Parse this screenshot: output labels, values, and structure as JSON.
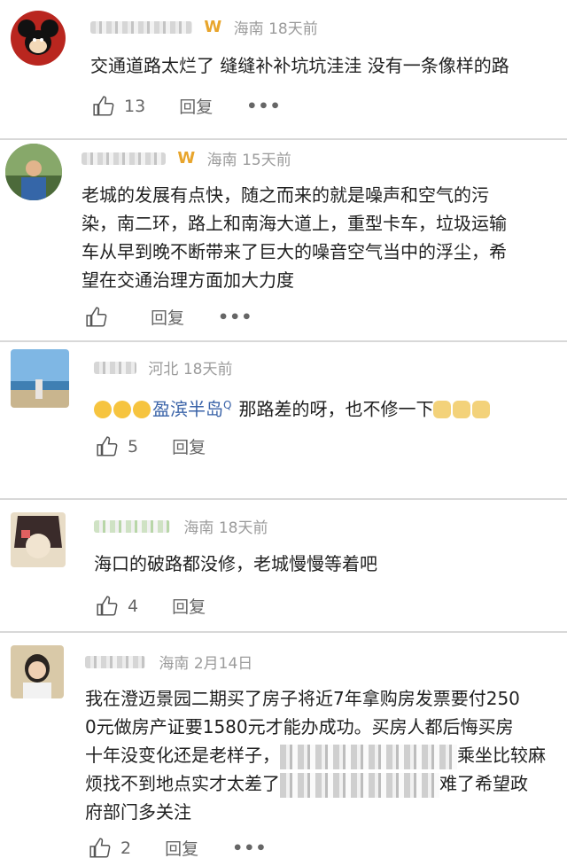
{
  "comments": [
    {
      "location": "海南",
      "time": "18天前",
      "vip_badge": "W",
      "text_lines": [
        "交通道路太烂了 缝缝补补坑坑洼洼 没有一条像样的路"
      ],
      "like_count": "13",
      "reply_label": "回复",
      "more_label": "•••"
    },
    {
      "location": "海南",
      "time": "15天前",
      "vip_badge": "W",
      "text_lines": [
        "老城的发展有点快，随之而来的就是噪声和空气的污",
        "染，南二环，路上和南海大道上，重型卡车，垃圾运输",
        "车从早到晚不断带来了巨大的噪音空气当中的浮尘，希",
        "望在交通治理方面加大力度"
      ],
      "like_count": "",
      "reply_label": "回复",
      "more_label": "•••"
    },
    {
      "location": "河北",
      "time": "18天前",
      "mention": "盈滨半岛",
      "mention_sup": "Q",
      "text_after": "那路差的呀，也不修一下",
      "like_count": "5",
      "reply_label": "回复"
    },
    {
      "location": "海南",
      "time": "18天前",
      "text_lines": [
        "海口的破路都没修，老城慢慢等着吧"
      ],
      "like_count": "4",
      "reply_label": "回复"
    },
    {
      "location": "海南",
      "time": "2月14日",
      "text_lines": [
        "我在澄迈景园二期买了房子将近7年拿购房发票要付250",
        "0元做房产证要1580元才能办成功。买房人都后悔买房",
        "十年没变化还是老样子，",
        "烦找不到地点实才太差了",
        "府部门多关注"
      ],
      "text_tail": {
        "line3": "乘坐比较麻",
        "line4": "难了希望政"
      },
      "like_count": "2",
      "reply_label": "回复",
      "more_label": "•••"
    }
  ],
  "colors": {
    "meta": "#9b9b9b",
    "mention": "#3a63a8",
    "badge": "#e8a52c",
    "divider": "#d8d8d8"
  }
}
